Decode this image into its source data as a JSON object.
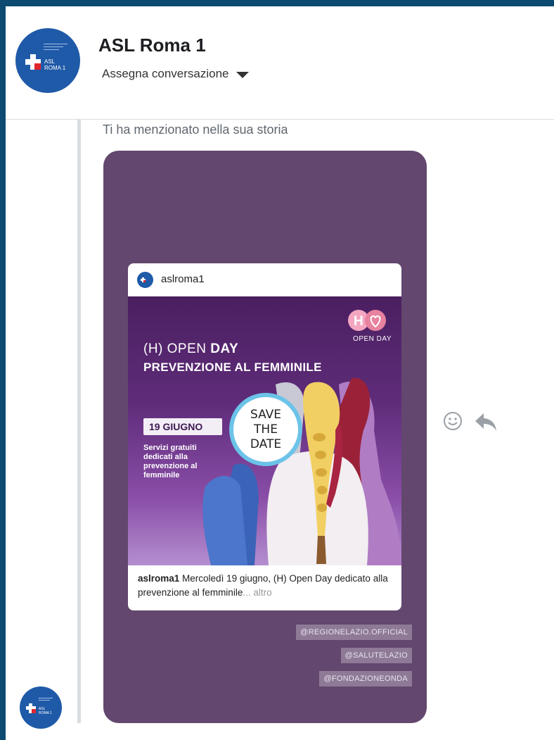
{
  "header": {
    "title": "ASL Roma 1",
    "assign_label": "Assegna conversazione",
    "avatar_logo_text": "ASL\nROMA 1"
  },
  "thread": {
    "mention_text": "Ti ha menzionato nella sua storia"
  },
  "story": {
    "background_color": "#63476e",
    "post": {
      "username": "aslroma1",
      "image": {
        "logo_caption": "OPEN DAY",
        "headline_part1": "(H) OPEN ",
        "headline_part1_bold": "DAY",
        "headline2": "PREVENZIONE AL FEMMINILE",
        "date": "19 GIUGNO",
        "services_text": "Servizi gratuiti dedicati alla prevenzione al femminile",
        "save_the_date": [
          "SAVE",
          "THE",
          "DATE"
        ]
      },
      "caption_user": "aslroma1",
      "caption_text": " Mercoledì 19 giugno, (H) Open Day dedicato alla prevenzione al femminile",
      "caption_more": "... altro"
    },
    "tags": [
      "@REGIONELAZIO.OFFICIAL",
      "@SALUTELAZIO",
      "@FONDAZIONEONDA"
    ]
  },
  "actions": [
    {
      "name": "react",
      "icon": "smiley-icon"
    },
    {
      "name": "reply",
      "icon": "reply-arrow-icon"
    }
  ]
}
